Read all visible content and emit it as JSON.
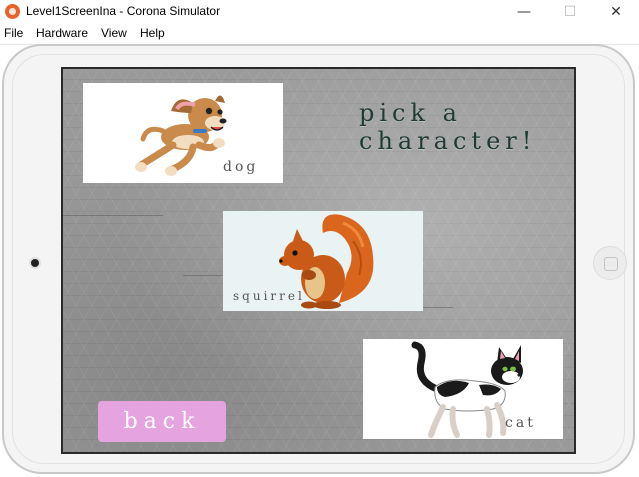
{
  "window": {
    "title": "Level1ScreenIna - Corona Simulator",
    "minimize_glyph": "—",
    "maximize_glyph": "☐",
    "close_glyph": "✕"
  },
  "menu": {
    "items": [
      "File",
      "Hardware",
      "View",
      "Help"
    ]
  },
  "screen": {
    "headline": "pick a character!",
    "characters": [
      {
        "label": "dog",
        "icon": "dog-icon"
      },
      {
        "label": "squirrel",
        "icon": "squirrel-icon"
      },
      {
        "label": "cat",
        "icon": "cat-icon"
      }
    ],
    "back_label": "back"
  },
  "colors": {
    "app_icon": "#e8632a",
    "headline": "#1f3a34",
    "back_button": "#e5a3e0",
    "screen_bg": "#9a9a9a"
  }
}
